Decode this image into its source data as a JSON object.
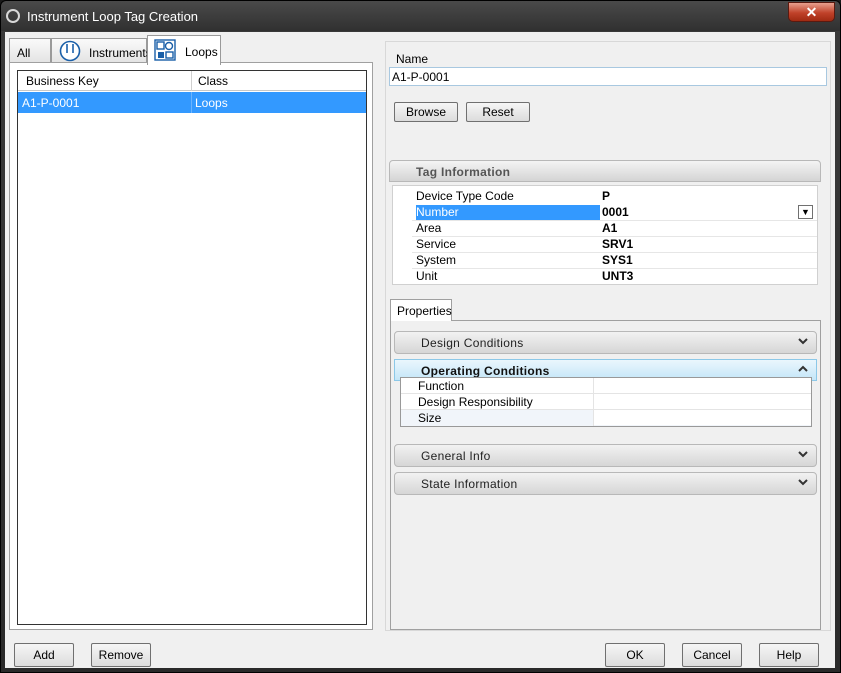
{
  "window": {
    "title": "Instrument Loop Tag Creation",
    "close_glyph": "✕"
  },
  "tabs": [
    {
      "label": "All",
      "icon": "none"
    },
    {
      "label": "Instruments",
      "icon": "instrument-gauge-icon"
    },
    {
      "label": "Loops",
      "icon": "loops-icon"
    }
  ],
  "grid": {
    "columns": [
      "Business Key",
      "Class"
    ],
    "rows": [
      {
        "business_key": "A1-P-0001",
        "class": "Loops"
      }
    ]
  },
  "name_field": {
    "label": "Name",
    "value": "A1-P-0001"
  },
  "buttons": {
    "browse": "Browse",
    "reset": "Reset",
    "add": "Add",
    "remove": "Remove",
    "ok": "OK",
    "cancel": "Cancel",
    "help": "Help"
  },
  "tag_information": {
    "title": "Tag Information",
    "rows": [
      {
        "label": "Device Type Code",
        "value": "P"
      },
      {
        "label": "Number",
        "value": "0001"
      },
      {
        "label": "Area",
        "value": "A1"
      },
      {
        "label": "Service",
        "value": "SRV1"
      },
      {
        "label": "System",
        "value": "SYS1"
      },
      {
        "label": "Unit",
        "value": "UNT3"
      }
    ]
  },
  "properties": {
    "tab_label": "Properties",
    "sections": [
      {
        "title": "Design Conditions",
        "expanded": false
      },
      {
        "title": "Operating Conditions",
        "expanded": true
      },
      {
        "title": "General Info",
        "expanded": false
      },
      {
        "title": "State Information",
        "expanded": false
      }
    ],
    "operating_rows": [
      {
        "label": "Function"
      },
      {
        "label": "Design Responsibility"
      },
      {
        "label": "Size"
      }
    ]
  },
  "colors": {
    "selection": "#3399ff",
    "window_chrome": "#2a2a2a",
    "close": "#c0422a"
  }
}
